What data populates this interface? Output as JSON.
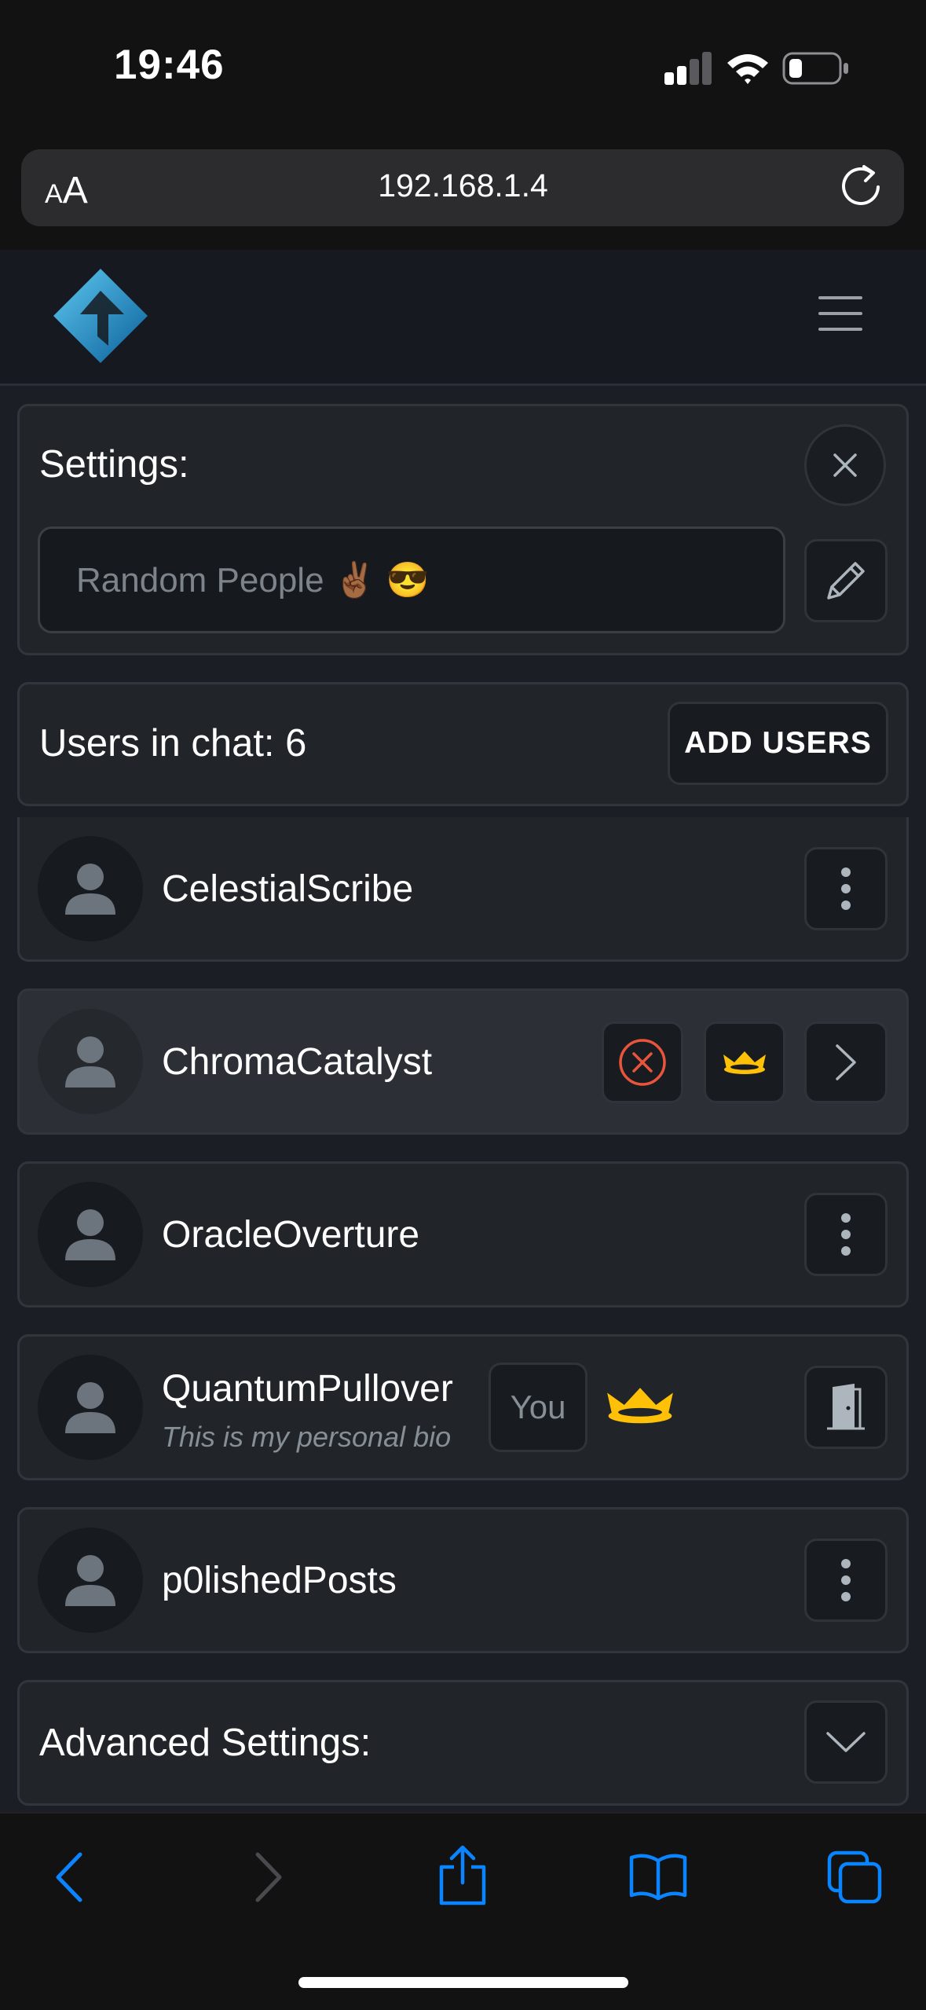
{
  "status_bar": {
    "time": "19:46",
    "battery_level": 0.2
  },
  "browser": {
    "text_size_label_small": "A",
    "text_size_label_large": "A",
    "url": "192.168.1.4"
  },
  "settings": {
    "title": "Settings:",
    "chat_name_placeholder": "Random People ✌🏾 😎"
  },
  "users_panel": {
    "count_label": "Users in chat: 6",
    "add_users_label": "ADD USERS"
  },
  "users": [
    {
      "name": "CelestialScribe"
    },
    {
      "name": "ChromaCatalyst"
    },
    {
      "name": "OracleOverture"
    },
    {
      "name": "QuantumPullover",
      "bio": "This is my personal bio",
      "you_badge": "You"
    },
    {
      "name": "p0lishedPosts"
    }
  ],
  "advanced": {
    "title": "Advanced Settings:"
  },
  "colors": {
    "accent_blue": "#0a84ff",
    "crown_yellow": "#ffc107",
    "danger_red": "#e8553c",
    "card_bg": "#212529"
  }
}
